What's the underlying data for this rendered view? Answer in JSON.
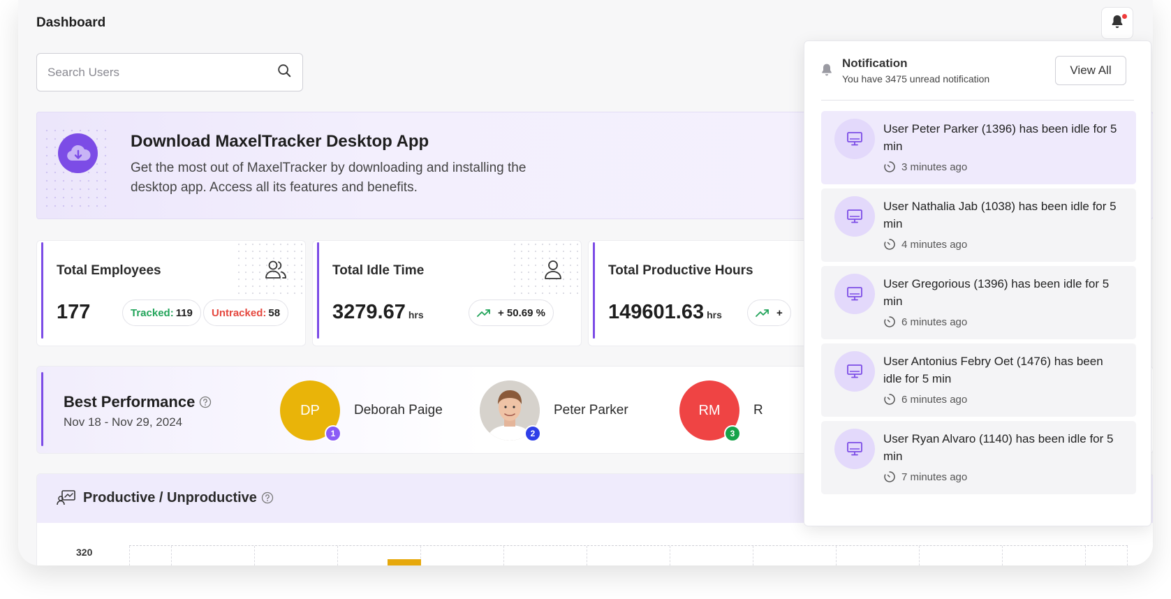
{
  "page": {
    "title": "Dashboard"
  },
  "search": {
    "placeholder": "Search Users"
  },
  "banner": {
    "title": "Download MaxelTracker Desktop App",
    "description": "Get the most out of MaxelTracker by downloading and installing the desktop app. Access all its features and benefits."
  },
  "cards": [
    {
      "title": "Total Employees",
      "value": "177",
      "unit": "",
      "icon": "users-icon",
      "tracked_label": "Tracked:",
      "tracked_value": "119",
      "untracked_label": "Untracked:",
      "untracked_value": "58"
    },
    {
      "title": "Total Idle Time",
      "value": "3279.67",
      "unit": "hrs",
      "icon": "user-icon",
      "change": "+ 50.69 %"
    },
    {
      "title": "Total Productive Hours",
      "value": "149601.63",
      "unit": "hrs",
      "icon": "clock-icon",
      "change": "+"
    }
  ],
  "best_performance": {
    "title": "Best Performance",
    "range": "Nov 18 - Nov 29, 2024",
    "performers": [
      {
        "initials": "DP",
        "name": "Deborah Paige",
        "rank": "1",
        "color": "#e9b409",
        "badge": "#8b5cf6"
      },
      {
        "initials": "",
        "name": "Peter Parker",
        "rank": "2",
        "color": "#d7d3cf",
        "badge": "#2f3fe8"
      },
      {
        "initials": "RM",
        "name": "R",
        "rank": "3",
        "color": "#ef4444",
        "badge": "#16a34a"
      }
    ]
  },
  "productive": {
    "title": "Productive / Unproductive",
    "y_tick": "320"
  },
  "notifications": {
    "title": "Notification",
    "subtitle": "You have 3475 unread notification",
    "view_all": "View All",
    "items": [
      {
        "text": "User Peter Parker  (1396) has been idle for 5 min",
        "time": "3 minutes ago"
      },
      {
        "text": "User Nathalia Jab (1038) has been idle for 5 min",
        "time": "4 minutes ago"
      },
      {
        "text": "User Gregorious    (1396) has been idle for 5 min",
        "time": "6 minutes ago"
      },
      {
        "text": "User Antonius Febry Oet  (1476) has been idle for 5 min",
        "time": "6 minutes ago"
      },
      {
        "text": "User Ryan Alvaro  (1140) has been idle for 5 min",
        "time": "7 minutes ago"
      }
    ]
  },
  "colors": {
    "accent": "#7c4ce6",
    "positive": "#22a45a",
    "negative": "#e5483f"
  }
}
